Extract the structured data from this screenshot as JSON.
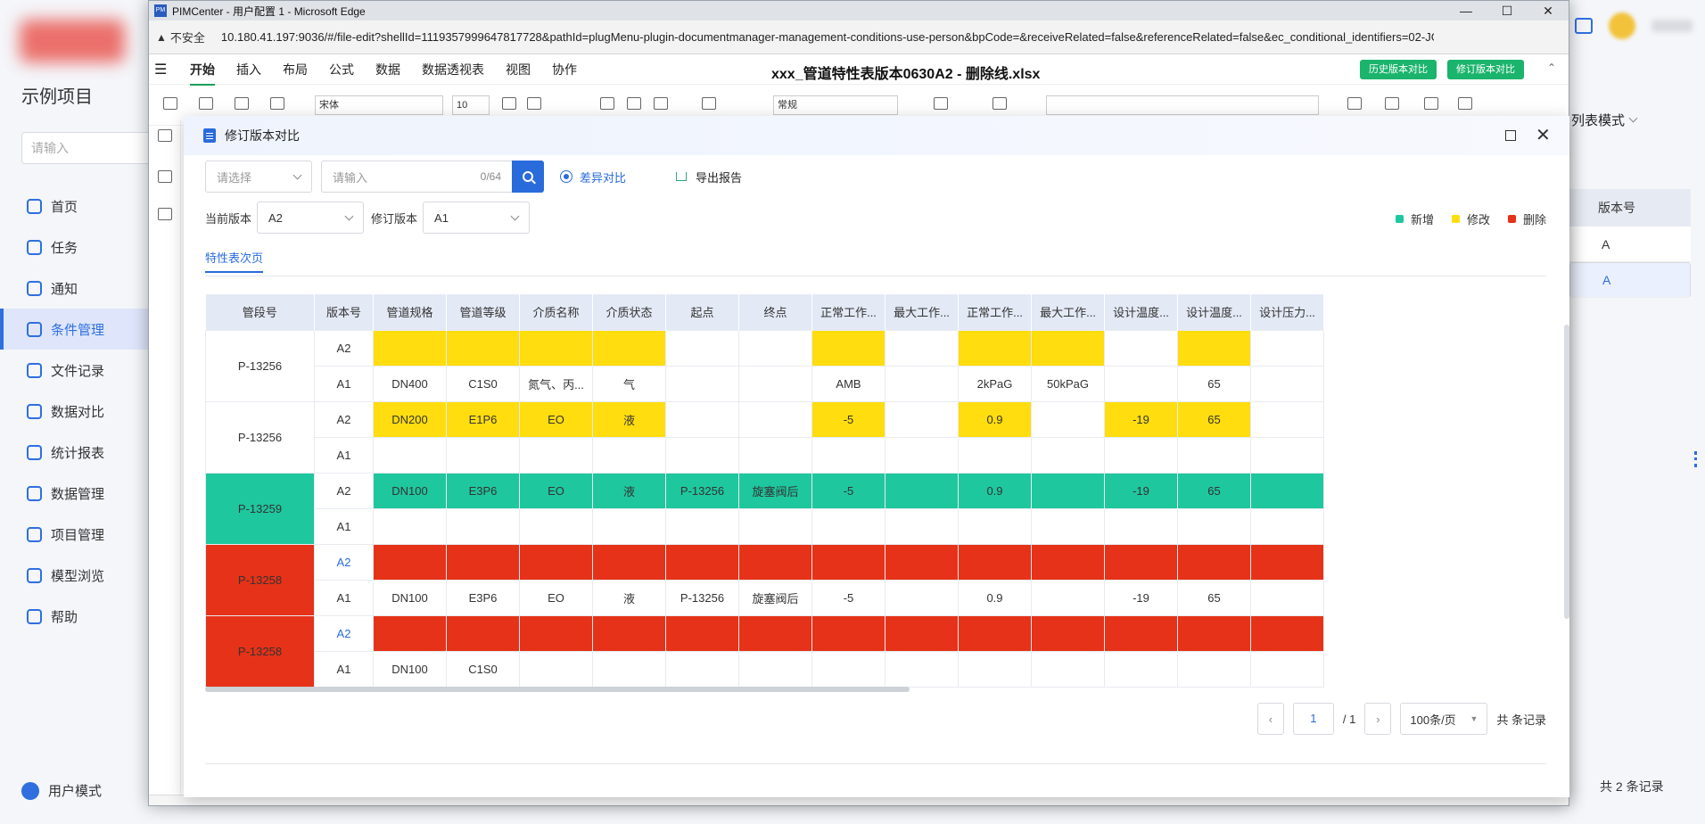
{
  "background": {
    "project_name": "示例项目",
    "search_placeholder": "请输入",
    "nav": [
      "首页",
      "任务",
      "通知",
      "条件管理",
      "文件记录",
      "数据对比",
      "统计报表",
      "数据管理",
      "项目管理",
      "模型浏览",
      "帮助"
    ],
    "active_nav": "条件管理",
    "user_mode": "用户模式",
    "list_mode": "列表模式",
    "table_header": "版本号",
    "table_rows": [
      "A",
      "A"
    ],
    "total_records": "共 2 条记录"
  },
  "edge": {
    "window_title": "PIMCenter - 用户配置 1 - Microsoft Edge",
    "insecure_label": "不安全",
    "url": "10.180.41.197:9036/#/file-edit?shellId=1119357999647817728&pathId=plugMenu-plugin-documentmanager-management-conditions-use-person&bpCode=&receiveRelated=false&referenceRelated=false&ec_conditional_identifiers=02-JG..."
  },
  "sheet": {
    "menu": [
      "开始",
      "插入",
      "布局",
      "公式",
      "数据",
      "数据透视表",
      "视图",
      "协作"
    ],
    "active_menu": "开始",
    "doc_title": "xxx_管道特性表版本0630A2 - 删除线.xlsx",
    "history_btn": "历史版本对比",
    "revise_btn": "修订版本对比",
    "font_name": "宋体",
    "font_size": "10",
    "number_format": "常规"
  },
  "modal": {
    "title": "修订版本对比",
    "select_placeholder": "请选择",
    "search_placeholder": "请输入",
    "search_count": "0/64",
    "diff_label": "差异对比",
    "export_label": "导出报告",
    "current_version_label": "当前版本",
    "current_version": "A2",
    "revision_label": "修订版本",
    "revision_version": "A1",
    "legend": [
      {
        "label": "新增",
        "color": "#1fc79e"
      },
      {
        "label": "修改",
        "color": "#ffdd0e"
      },
      {
        "label": "删除",
        "color": "#e63218"
      }
    ],
    "tab": "特性表次页",
    "columns": [
      "管段号",
      "版本号",
      "管道规格",
      "管道等级",
      "介质名称",
      "介质状态",
      "起点",
      "终点",
      "正常工作...",
      "最大工作...",
      "正常工作...",
      "最大工作...",
      "设计温度...",
      "设计温度...",
      "设计压力..."
    ],
    "groups": [
      {
        "seg": "P-13256",
        "seg_status": "normal",
        "rows": [
          {
            "ver": "A2",
            "row_status": "normal",
            "cells": [
              "",
              "",
              "",
              "",
              "",
              "",
              "",
              "",
              "",
              "",
              "",
              "",
              ""
            ],
            "mod": [
              0,
              1,
              2,
              3,
              6,
              8,
              9,
              11
            ]
          },
          {
            "ver": "A1",
            "row_status": "normal",
            "cells": [
              "DN400",
              "C1S0",
              "氮气、丙...",
              "气",
              "",
              "",
              "AMB",
              "",
              "2kPaG",
              "50kPaG",
              "",
              "65",
              ""
            ],
            "mod": []
          }
        ]
      },
      {
        "seg": "P-13256",
        "seg_status": "normal",
        "rows": [
          {
            "ver": "A2",
            "row_status": "normal",
            "cells": [
              "DN200",
              "E1P6",
              "EO",
              "液",
              "",
              "",
              "-5",
              "",
              "0.9",
              "",
              "-19",
              "65",
              ""
            ],
            "mod": [
              0,
              1,
              2,
              3,
              6,
              8,
              10,
              11
            ]
          },
          {
            "ver": "A1",
            "row_status": "normal",
            "cells": [
              "",
              "",
              "",
              "",
              "",
              "",
              "",
              "",
              "",
              "",
              "",
              "",
              ""
            ],
            "mod": []
          }
        ]
      },
      {
        "seg": "P-13259",
        "seg_status": "add",
        "rows": [
          {
            "ver": "A2",
            "row_status": "add",
            "cells": [
              "DN100",
              "E3P6",
              "EO",
              "液",
              "P-13256",
              "旋塞阀后",
              "-5",
              "",
              "0.9",
              "",
              "-19",
              "65",
              ""
            ],
            "mod": []
          },
          {
            "ver": "A1",
            "row_status": "normal",
            "cells": [
              "",
              "",
              "",
              "",
              "",
              "",
              "",
              "",
              "",
              "",
              "",
              "",
              ""
            ],
            "mod": []
          }
        ]
      },
      {
        "seg": "P-13258",
        "seg_status": "del",
        "rows": [
          {
            "ver": "A2",
            "row_status": "del",
            "cells": [
              "",
              "",
              "",
              "",
              "",
              "",
              "",
              "",
              "",
              "",
              "",
              "",
              ""
            ],
            "mod": []
          },
          {
            "ver": "A1",
            "row_status": "normal",
            "cells": [
              "DN100",
              "E3P6",
              "EO",
              "液",
              "P-13256",
              "旋塞阀后",
              "-5",
              "",
              "0.9",
              "",
              "-19",
              "65",
              ""
            ],
            "mod": []
          }
        ]
      },
      {
        "seg": "P-13258",
        "seg_status": "del2",
        "rows": [
          {
            "ver": "A2",
            "row_status": "del",
            "cells": [
              "",
              "",
              "",
              "",
              "",
              "",
              "",
              "",
              "",
              "",
              "",
              "",
              ""
            ],
            "mod": []
          },
          {
            "ver": "A1",
            "row_status": "normal",
            "cells": [
              "DN100",
              "C1S0",
              "",
              "",
              "",
              "",
              "",
              "",
              "",
              "",
              "",
              "",
              ""
            ],
            "mod": []
          }
        ]
      }
    ],
    "pager": {
      "page": "1",
      "total_pages": "/ 1",
      "page_size": "100条/页",
      "total_label": "共  条记录"
    }
  }
}
